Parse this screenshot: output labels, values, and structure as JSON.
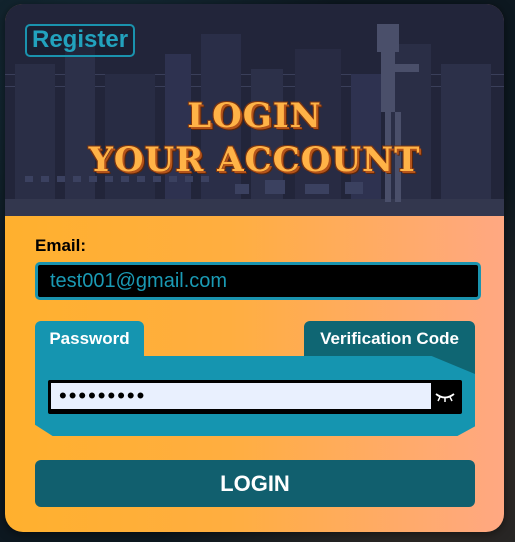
{
  "header": {
    "register_label": "Register",
    "title_line1": "LOGIN",
    "title_line2": "YOUR ACCOUNT"
  },
  "form": {
    "email_label": "Email:",
    "email_value": "test001@gmail.com",
    "tabs": [
      {
        "label": "Password",
        "active": true
      },
      {
        "label": "Verification Code",
        "active": false
      }
    ],
    "password_value": "•••••••••",
    "login_label": "LOGIN"
  },
  "colors": {
    "accent": "#1595b0",
    "accent_dark": "#115f6e",
    "card_gradient_start": "#ffb02e",
    "card_gradient_end": "#ffa882"
  },
  "icons": {
    "password_toggle": "eye-closed-icon"
  }
}
